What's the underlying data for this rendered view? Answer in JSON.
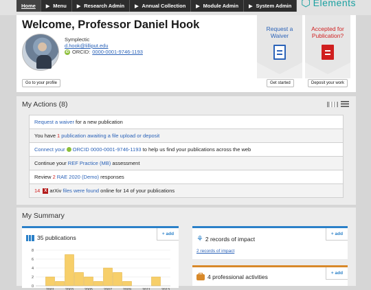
{
  "nav": {
    "items": [
      "Home",
      "Menu",
      "Research Admin",
      "Annual Collection",
      "Module Admin",
      "System Admin"
    ],
    "brand": "Elements"
  },
  "welcome": {
    "title": "Welcome, Professor Daniel Hook",
    "organization": "Symplectic",
    "email": "d.hook@lilliput.edu",
    "orcid_label": "ORCID:",
    "orcid_id": "0000-0001-9746-1193",
    "profile_button": "Go to your profile",
    "tiles": [
      {
        "label": "Request a Waiver",
        "button": "Get started",
        "color": "#2a62b8"
      },
      {
        "label": "Accepted for Publication?",
        "button": "Deposit your work",
        "color": "#d01f1f"
      }
    ]
  },
  "actions": {
    "title": "My Actions (8)",
    "rows": [
      {
        "link": "Request a waiver",
        "rest": " for a new publication"
      },
      {
        "pre": "You have ",
        "count": "1",
        "link": "publication awaiting a file upload or deposit"
      },
      {
        "link": "Connect your",
        "orcid": "ORCID 0000-0001-9746-1193",
        "rest": " to help us find your publications across the web"
      },
      {
        "pre": "Continue your ",
        "link": "REF Practice (MB)",
        "rest": " assessment"
      },
      {
        "pre": "Review ",
        "count": "2",
        "link": "RAE 2020 (Demo)",
        "rest": " responses"
      },
      {
        "count": "14",
        "badge": "X",
        "pre": " arXiv ",
        "link": "files were found",
        "rest": " online for 14 of your publications"
      }
    ]
  },
  "summary": {
    "title": "My Summary",
    "cards": {
      "publications": {
        "title": "35 publications",
        "add": "+ add"
      },
      "impact": {
        "title": "2 records of impact",
        "add": "+ add",
        "link": "2 records of impact"
      },
      "professional": {
        "title": "4 professional activities",
        "add": "+ add"
      }
    }
  },
  "chart_data": {
    "type": "bar",
    "categories": [
      "",
      "2001",
      "",
      "2003",
      "",
      "2005",
      "",
      "2007",
      "",
      "2009",
      "",
      "2011",
      "",
      "2013"
    ],
    "values": [
      2,
      1,
      7,
      3,
      2,
      1,
      4,
      3,
      1,
      0,
      0,
      2
    ],
    "ylim": [
      0,
      8
    ],
    "yticks": [
      "0",
      "2",
      "4",
      "6",
      "8"
    ],
    "xticks": [
      "2001",
      "2003",
      "2005",
      "2007",
      "2009",
      "2011",
      "2013"
    ],
    "bar_color": "#f7cf6a",
    "grid": true
  }
}
